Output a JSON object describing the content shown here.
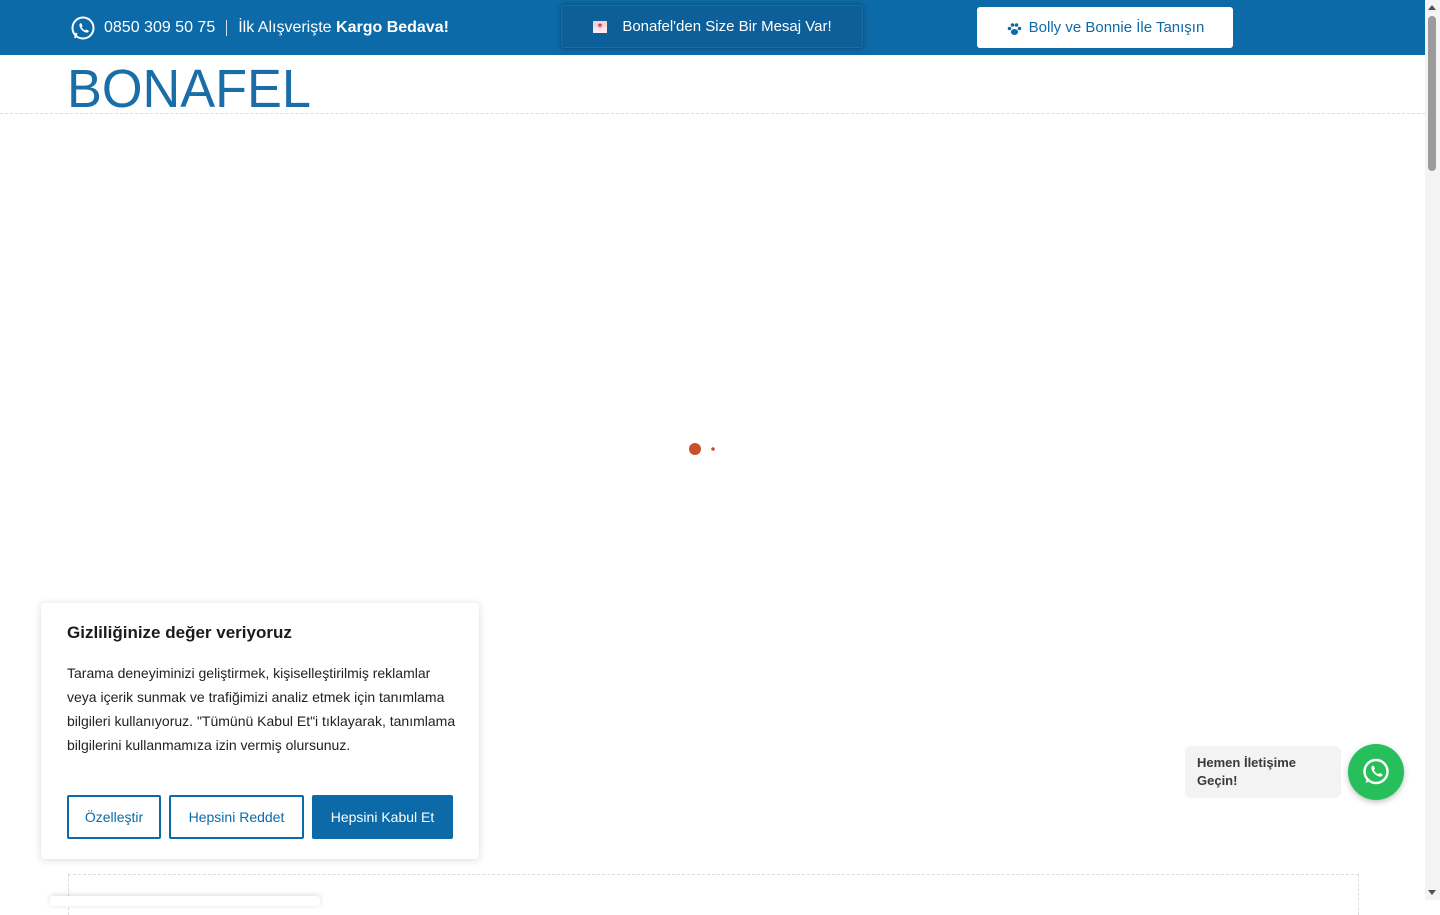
{
  "topbar": {
    "phone": "0850 309 50 75",
    "promo_prefix": "İlk Alışverişte ",
    "promo_bold": "Kargo Bedava!",
    "message_button": "Bonafel'den Size Bir Mesaj Var!",
    "bolly_button": "Bolly ve Bonnie İle Tanışın",
    "bg_color": "#0d6aa8"
  },
  "header": {
    "logo_text": "BONAFEL"
  },
  "cookie_banner": {
    "title": "Gizliliğinize değer veriyoruz",
    "body": "Tarama deneyiminizi geliştirmek, kişiselleştirilmiş reklamlar veya içerik sunmak ve trafiğimizi analiz etmek için tanımlama bilgileri kullanıyoruz. \"Tümünü Kabul Et\"i tıklayarak, tanımlama bilgilerini kullanmamıza izin vermiş olursunuz.",
    "customize_label": "Özelleştir",
    "reject_label": "Hepsini Reddet",
    "accept_label": "Hepsini Kabul Et"
  },
  "whatsapp_widget": {
    "label": "Hemen İletişime Geçin!",
    "icon": "whatsapp-icon"
  },
  "loader": {
    "color": "#c8502a"
  }
}
